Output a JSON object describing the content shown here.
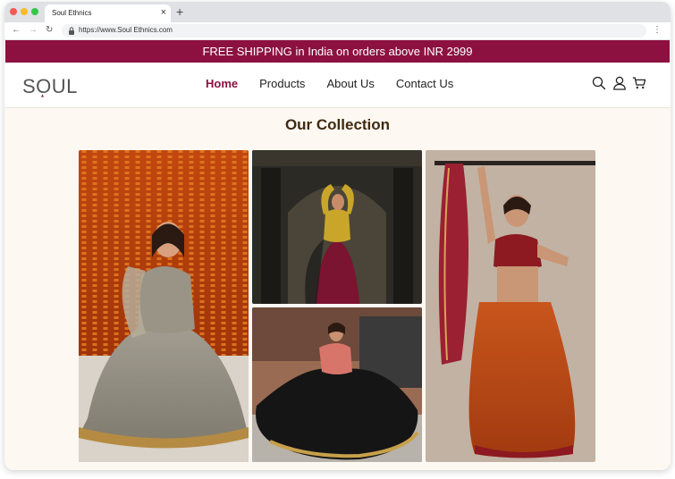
{
  "browser": {
    "tab_title": "Soul Ethnics",
    "tab_close": "×",
    "new_tab": "+",
    "url": "https://www.Soul Ethnics.com",
    "back": "←",
    "forward": "→",
    "reload": "↻",
    "menu": "⋮"
  },
  "promo": {
    "text": "FREE SHIPPING in India on orders above INR 2999"
  },
  "header": {
    "logo_text": "SOUL",
    "nav": [
      {
        "label": "Home",
        "active": true
      },
      {
        "label": "Products",
        "active": false
      },
      {
        "label": "About Us",
        "active": false
      },
      {
        "label": "Contact Us",
        "active": false
      }
    ],
    "icons": [
      "search-icon",
      "user-icon",
      "cart-icon"
    ]
  },
  "collection": {
    "title": "Our Collection",
    "photos": [
      {
        "name": "photo-grey-lehenga"
      },
      {
        "name": "photo-yellow-choli-maroon-skirt"
      },
      {
        "name": "photo-black-twirl-lehenga"
      },
      {
        "name": "photo-orange-lehenga-dupatta"
      }
    ]
  },
  "colors": {
    "brand": "#8c1140",
    "heading": "#3f2a10",
    "page_bg": "#fdf8f2"
  }
}
